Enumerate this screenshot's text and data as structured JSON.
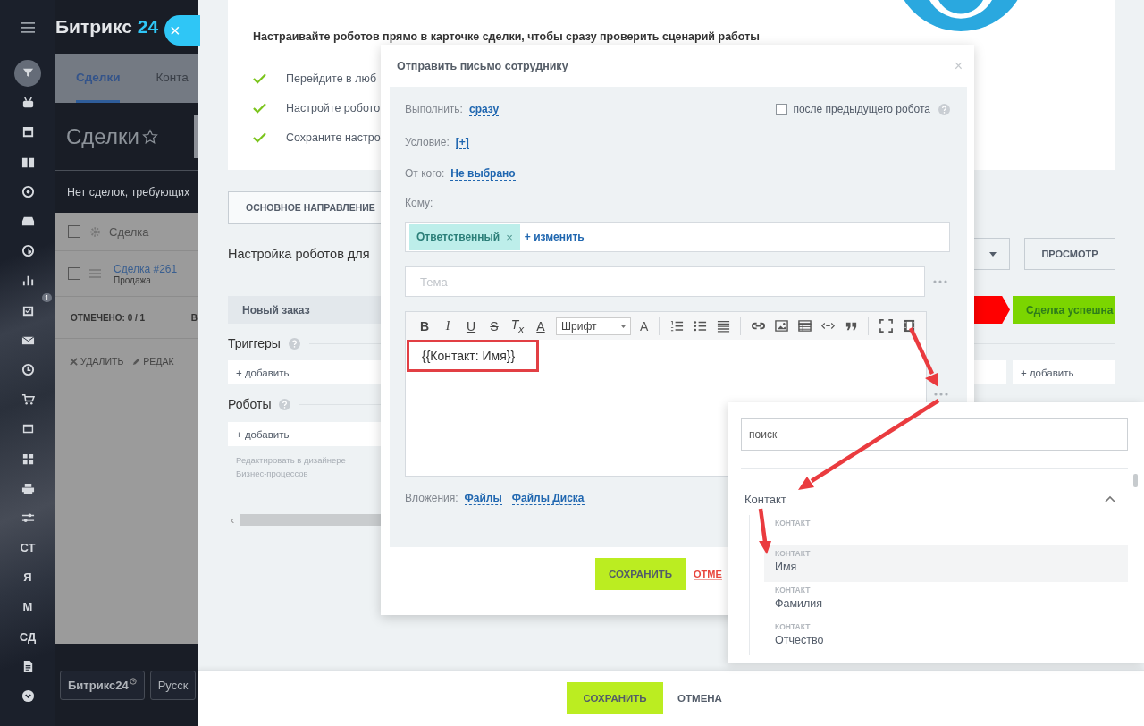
{
  "crm": {
    "logo": {
      "text": "Битрикс",
      "accent": "24"
    },
    "close_button": {
      "label": "×"
    },
    "sidebar": [
      {
        "kind": "icon",
        "selected": true
      },
      {
        "kind": "icon",
        "selected": false
      },
      {
        "kind": "icon",
        "selected": false
      },
      {
        "kind": "icon",
        "selected": false
      },
      {
        "kind": "icon",
        "selected": false
      },
      {
        "kind": "icon",
        "selected": false
      },
      {
        "kind": "icon",
        "selected": false
      },
      {
        "kind": "icon",
        "selected": false
      },
      {
        "kind": "icon",
        "selected": false,
        "badge": "1"
      },
      {
        "kind": "icon",
        "selected": false
      },
      {
        "kind": "icon",
        "selected": false
      },
      {
        "kind": "icon",
        "selected": false
      },
      {
        "kind": "icon",
        "selected": false
      },
      {
        "kind": "icon",
        "selected": false
      },
      {
        "kind": "icon",
        "selected": false
      },
      {
        "kind": "icon",
        "selected": false
      },
      {
        "kind": "text",
        "label": "СТ",
        "selected": false
      },
      {
        "kind": "text",
        "label": "Я",
        "selected": false
      },
      {
        "kind": "text",
        "label": "М",
        "selected": false
      },
      {
        "kind": "text",
        "label": "СД",
        "selected": false
      },
      {
        "kind": "icon",
        "selected": false
      },
      {
        "kind": "icon",
        "selected": false
      }
    ],
    "tabs": [
      {
        "label": "Сделки",
        "selected": true
      },
      {
        "label": "Конта",
        "selected": false
      }
    ],
    "title": "Сделки",
    "notice": "Нет сделок, требующих",
    "grid": {
      "select_all_checked": false,
      "column": "Сделка",
      "rows": [
        {
          "title": "Сделка #261",
          "subtitle": "Продажа",
          "checked": false
        }
      ],
      "selected_count": "ОТМЕЧЕНО: 0 / 1",
      "column_2": "В",
      "actions": [
        "УДАЛИТЬ",
        "РЕДАК"
      ]
    },
    "footer_buttons": [
      "Битрикс24",
      "Русск"
    ]
  },
  "robots_panel": {
    "intro": {
      "heading": "Настраивайте роботов прямо в карточке сделки, чтобы сразу проверить сценарий работы",
      "steps": [
        "Перейдите в люб",
        "Настройте робото",
        "Сохраните настро"
      ]
    },
    "direction_button": "ОСНОВНОЕ НАПРАВЛЕНИЕ",
    "title": "Настройка роботов для",
    "preview_button": "ПРОСМОТР",
    "stages": [
      {
        "label": "Новый заказ",
        "color": "#e3e8ec"
      },
      {
        "color": "#ff0000"
      },
      {
        "label": "Сделка успешна",
        "color": "#7bd500"
      }
    ],
    "triggers": {
      "heading": "Триггеры",
      "add": [
        "+ добавить",
        "+ добавить"
      ]
    },
    "robots": {
      "heading": "Роботы",
      "add": "+ добавить",
      "designer_link": "Редактировать в дизайнере Бизнес-процессов"
    },
    "scroll_left": "‹",
    "save_button": "СОХРАНИТЬ",
    "cancel_button": "ОТМЕНА"
  },
  "dialog": {
    "title": "Отправить письмо сотруднику",
    "close": "×",
    "execute": {
      "label": "Выполнить:",
      "value": "сразу"
    },
    "after_previous": {
      "label": "после предыдущего робота",
      "checked": false
    },
    "condition": {
      "label": "Условие:",
      "value": "[+]"
    },
    "from": {
      "label": "От кого:",
      "value": "Не выбрано"
    },
    "to": {
      "label": "Кому:",
      "chips": [
        {
          "label": "Ответственный",
          "remove": "×"
        }
      ],
      "change": "+ изменить"
    },
    "subject": {
      "placeholder": "Тема"
    },
    "editor": {
      "format_buttons": [
        "B",
        "I",
        "U",
        "S",
        "T$_{x}$",
        "A"
      ],
      "font": "Шрифт",
      "size": "A",
      "value": "{{Контакт: Имя}}",
      "highlighted": true
    },
    "attachments": {
      "label": "Вложения:",
      "links": [
        "Файлы",
        "Файлы Диска"
      ]
    },
    "save_button": "СОХРАНИТЬ",
    "cancel_button": "ОТМЕ"
  },
  "popup": {
    "search": {
      "placeholder": "поиск"
    },
    "group": {
      "label": "Контакт",
      "expanded": true,
      "items": [
        {
          "caption": "КОНТАКТ",
          "selected": false
        },
        {
          "caption": "КОНТАКТ",
          "label": "Имя",
          "selected": true
        },
        {
          "caption": "КОНТАКТ",
          "label": "Фамилия",
          "selected": false
        },
        {
          "caption": "КОНТАКТ",
          "label": "Отчество",
          "selected": false
        }
      ]
    }
  }
}
